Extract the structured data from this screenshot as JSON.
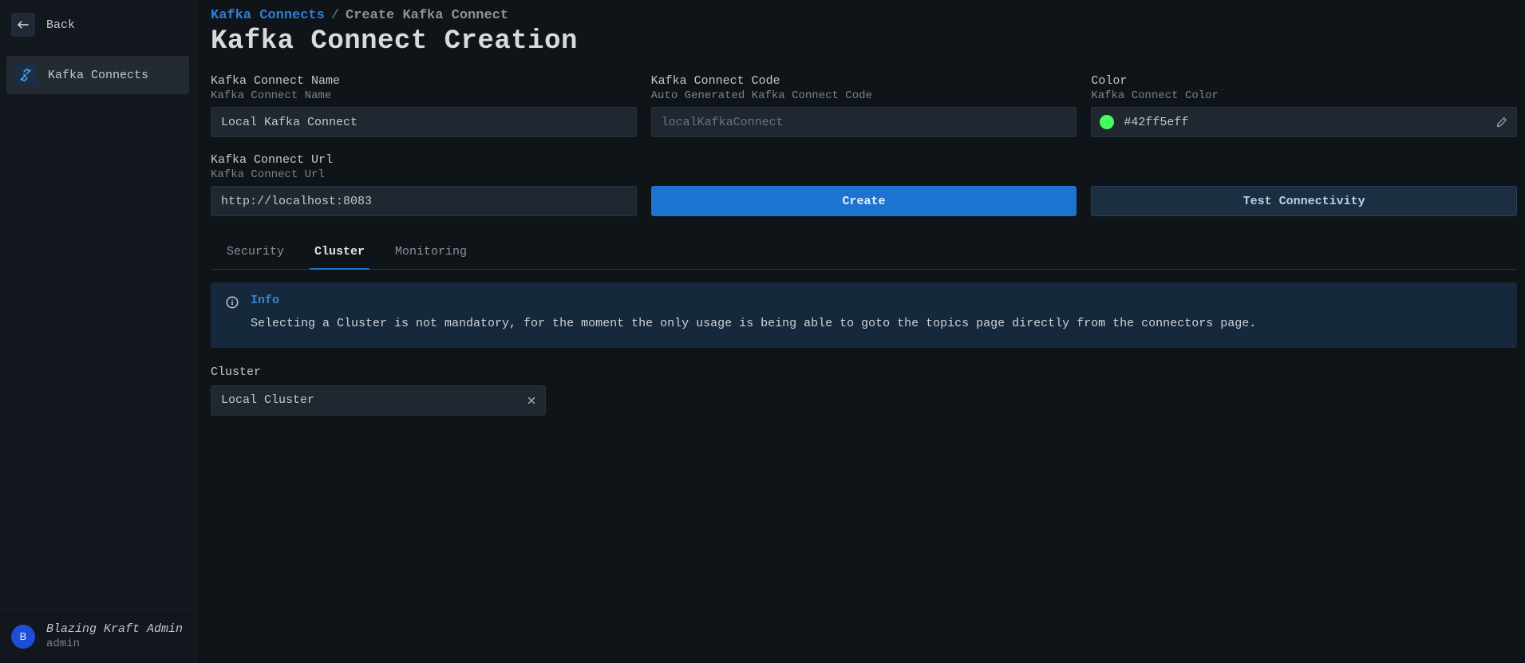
{
  "sidebar": {
    "back_label": "Back",
    "items": [
      {
        "label": "Kafka Connects"
      }
    ]
  },
  "user": {
    "initial": "B",
    "display_name": "Blazing Kraft Admin",
    "username": "admin"
  },
  "breadcrumbs": {
    "parent": "Kafka Connects",
    "current": "Create Kafka Connect"
  },
  "page_title": "Kafka Connect Creation",
  "fields": {
    "name": {
      "label": "Kafka Connect Name",
      "sublabel": "Kafka Connect Name",
      "value": "Local Kafka Connect"
    },
    "code": {
      "label": "Kafka Connect Code",
      "sublabel": "Auto Generated Kafka Connect Code",
      "placeholder": "localKafkaConnect"
    },
    "color": {
      "label": "Color",
      "sublabel": "Kafka Connect Color",
      "hex": "#42ff5eff",
      "swatch": "#42ff5e"
    },
    "url": {
      "label": "Kafka Connect Url",
      "sublabel": "Kafka Connect Url",
      "value": "http://localhost:8083"
    }
  },
  "buttons": {
    "create": "Create",
    "test": "Test Connectivity"
  },
  "tabs": [
    {
      "label": "Security",
      "active": false
    },
    {
      "label": "Cluster",
      "active": true
    },
    {
      "label": "Monitoring",
      "active": false
    }
  ],
  "info": {
    "title": "Info",
    "body": "Selecting a Cluster is not mandatory, for the moment the only usage is being able to goto the topics page directly from the connectors page."
  },
  "cluster": {
    "label": "Cluster",
    "value": "Local Cluster"
  }
}
